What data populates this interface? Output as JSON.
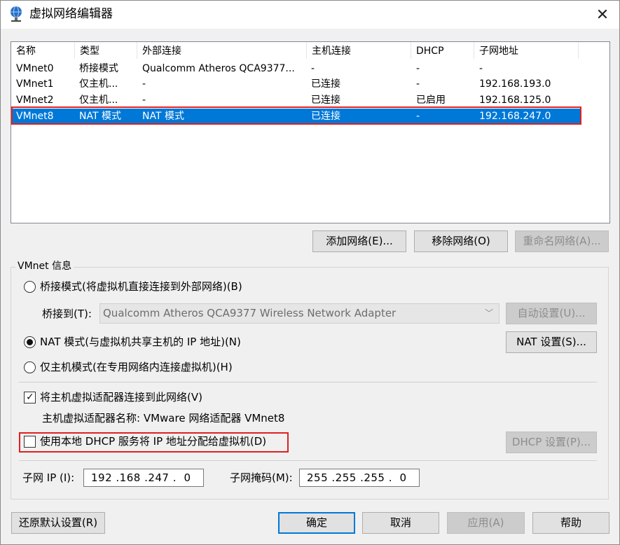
{
  "window": {
    "title": "虚拟网络编辑器",
    "close_symbol": "✕"
  },
  "list": {
    "columns": [
      "名称",
      "类型",
      "外部连接",
      "主机连接",
      "DHCP",
      "子网地址"
    ],
    "rows": [
      {
        "name": "VMnet0",
        "type": "桥接模式",
        "external": "Qualcomm Atheros QCA9377...",
        "host": "-",
        "dhcp": "-",
        "subnet": "-"
      },
      {
        "name": "VMnet1",
        "type": "仅主机...",
        "external": "-",
        "host": "已连接",
        "dhcp": "-",
        "subnet": "192.168.193.0"
      },
      {
        "name": "VMnet2",
        "type": "仅主机...",
        "external": "-",
        "host": "已连接",
        "dhcp": "已启用",
        "subnet": "192.168.125.0"
      },
      {
        "name": "VMnet8",
        "type": "NAT 模式",
        "external": "NAT 模式",
        "host": "已连接",
        "dhcp": "-",
        "subnet": "192.168.247.0"
      }
    ],
    "selected_index": 3
  },
  "list_buttons": {
    "add": "添加网络(E)...",
    "remove": "移除网络(O)",
    "rename": "重命名网络(A)..."
  },
  "vmnet_info": {
    "group_title": "VMnet 信息",
    "bridged_label": "桥接模式(将虚拟机直接连接到外部网络)(B)",
    "bridge_to_label": "桥接到(T):",
    "bridge_adapter": "Qualcomm Atheros QCA9377 Wireless Network Adapter",
    "auto_settings": "自动设置(U)...",
    "nat_label": "NAT 模式(与虚拟机共享主机的 IP 地址)(N)",
    "nat_settings": "NAT 设置(S)...",
    "hostonly_label": "仅主机模式(在专用网络内连接虚拟机)(H)",
    "selected_mode": "nat",
    "connect_adapter_label": "将主机虚拟适配器连接到此网络(V)",
    "connect_adapter_checked": true,
    "adapter_name_label": "主机虚拟适配器名称: VMware 网络适配器 VMnet8",
    "dhcp_label": "使用本地 DHCP 服务将 IP 地址分配给虚拟机(D)",
    "dhcp_checked": false,
    "dhcp_settings": "DHCP 设置(P)...",
    "subnet_ip_label": "子网 IP (I):",
    "subnet_ip": "192 .168 .247 .  0",
    "subnet_mask_label": "子网掩码(M):",
    "subnet_mask": "255 .255 .255 .  0"
  },
  "footer": {
    "restore": "还原默认设置(R)",
    "ok": "确定",
    "cancel": "取消",
    "apply": "应用(A)",
    "help": "帮助"
  },
  "colors": {
    "selection": "#0078d7",
    "highlight_outline": "#e02020"
  }
}
